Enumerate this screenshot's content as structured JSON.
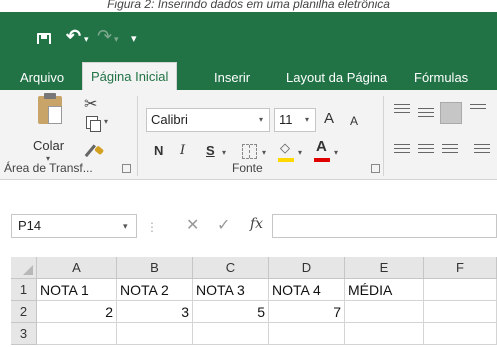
{
  "caption": "Figura 2: Inserindo dados em uma planilha eletrônica",
  "qat": {
    "undo_glyph": "↶",
    "redo_glyph": "↷",
    "dd_glyph": "▾",
    "customize_glyph": "₌"
  },
  "tabs": [
    {
      "label": "Arquivo",
      "active": false
    },
    {
      "label": "Página Inicial",
      "active": true
    },
    {
      "label": "Inserir",
      "active": false
    },
    {
      "label": "Layout da Página",
      "active": false
    },
    {
      "label": "Fórmulas",
      "active": false
    }
  ],
  "ribbon": {
    "clipboard": {
      "paste_label": "Colar",
      "group_label": "Área de Transf...",
      "cut_glyph": "✂"
    },
    "font": {
      "font_name": "Calibri",
      "font_size": "11",
      "grow_label": "A",
      "shrink_label": "A",
      "bold_label": "N",
      "italic_label": "I",
      "underline_label": "S",
      "fill_glyph": "◇",
      "fontcolor_label": "A",
      "group_label": "Fonte"
    }
  },
  "formula_bar": {
    "name_box": "P14",
    "cancel_glyph": "✕",
    "enter_glyph": "✓",
    "fx_label": "fx",
    "sep_glyph": "⋮",
    "formula": ""
  },
  "sheet": {
    "columns": [
      "A",
      "B",
      "C",
      "D",
      "E",
      "F"
    ],
    "rows": [
      {
        "header": "1",
        "cells": [
          "NOTA 1",
          "NOTA 2",
          "NOTA 3",
          "NOTA 4",
          "MÉDIA",
          ""
        ]
      },
      {
        "header": "2",
        "cells": [
          "2",
          "3",
          "5",
          "7",
          "",
          ""
        ]
      },
      {
        "header": "3",
        "cells": [
          "",
          "",
          "",
          "",
          "",
          ""
        ]
      }
    ]
  }
}
